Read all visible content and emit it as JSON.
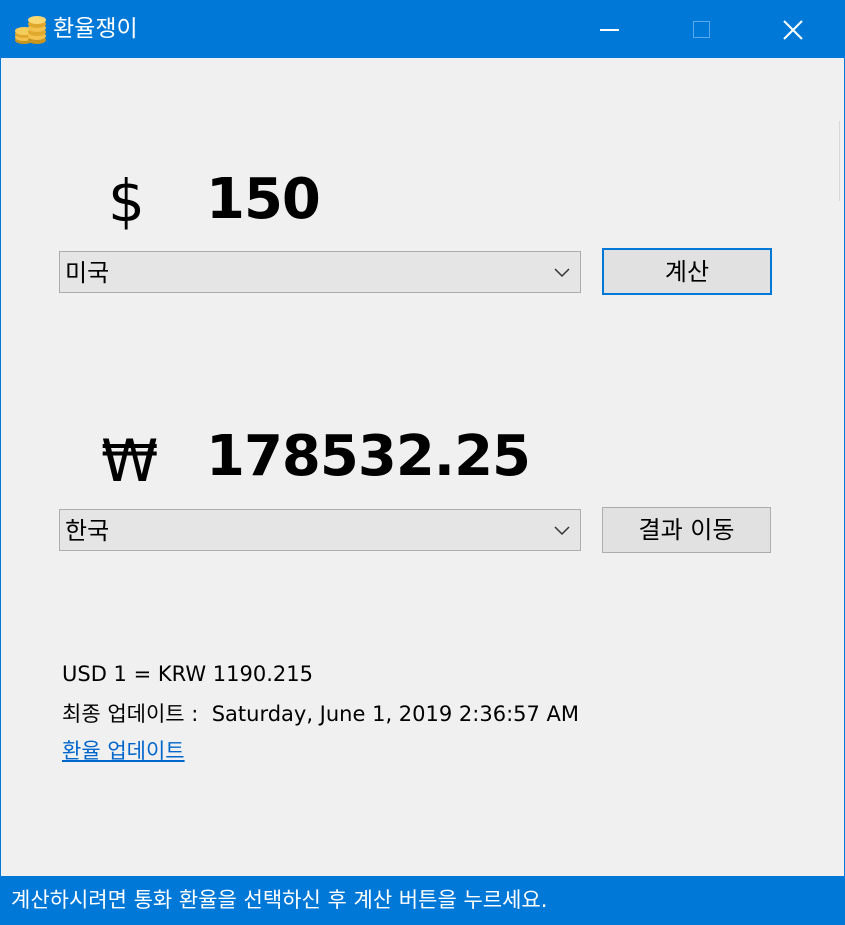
{
  "window": {
    "title": "환율쟁이",
    "icon": "coin-stack-icon",
    "accent_color": "#0078d7"
  },
  "titlebar_buttons": {
    "minimize": "minimize-icon",
    "maximize": "maximize-icon",
    "close": "✕"
  },
  "source": {
    "symbol": "$",
    "amount": "150",
    "country": "미국"
  },
  "target": {
    "symbol": "₩",
    "amount": "178532.25",
    "country": "한국"
  },
  "buttons": {
    "calculate": "계산",
    "move_result": "결과 이동"
  },
  "info": {
    "rate": "USD 1 = KRW 1190.215",
    "last_update": "최종 업데이트 :  Saturday, June 1, 2019 2:36:57 AM",
    "update_link": "환율 업데이트"
  },
  "status": {
    "message": "계산하시려면 통화 환율을 선택하신 후 계산 버튼을 누르세요."
  }
}
